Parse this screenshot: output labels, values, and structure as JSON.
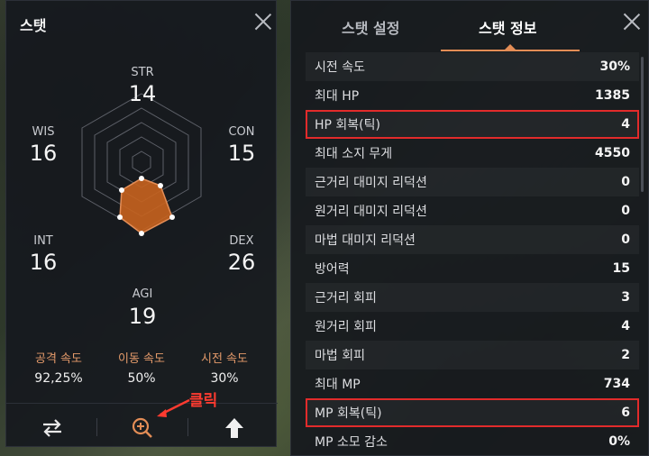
{
  "left_panel": {
    "title": "스탯",
    "stats": {
      "str": {
        "label": "STR",
        "value": "14"
      },
      "con": {
        "label": "CON",
        "value": "15"
      },
      "dex": {
        "label": "DEX",
        "value": "26"
      },
      "agi": {
        "label": "AGI",
        "value": "19"
      },
      "int": {
        "label": "INT",
        "value": "16"
      },
      "wis": {
        "label": "WIS",
        "value": "16"
      }
    },
    "speeds": [
      {
        "label": "공격 속도",
        "value": "92,25%"
      },
      {
        "label": "이동 속도",
        "value": "50%"
      },
      {
        "label": "시전 속도",
        "value": "30%"
      }
    ],
    "footer": {
      "swap_icon": "swap-arrows-icon",
      "zoom_icon": "zoom-in-icon",
      "upgrade_icon": "upgrade-arrow-icon"
    },
    "annotation": "클릭"
  },
  "right_panel": {
    "tabs": [
      {
        "label": "스탯 설정",
        "active": false
      },
      {
        "label": "스탯 정보",
        "active": true
      }
    ],
    "rows": [
      {
        "name": "시전 속도",
        "value": "30%",
        "highlight": false
      },
      {
        "name": "최대 HP",
        "value": "1385",
        "highlight": false
      },
      {
        "name": "HP 회복(틱)",
        "value": "4",
        "highlight": true
      },
      {
        "name": "최대 소지 무게",
        "value": "4550",
        "highlight": false
      },
      {
        "name": "근거리 대미지 리덕션",
        "value": "0",
        "highlight": false
      },
      {
        "name": "원거리 대미지 리덕션",
        "value": "0",
        "highlight": false
      },
      {
        "name": "마법 대미지 리덕션",
        "value": "0",
        "highlight": false
      },
      {
        "name": "방어력",
        "value": "15",
        "highlight": false
      },
      {
        "name": "근거리 회피",
        "value": "3",
        "highlight": false
      },
      {
        "name": "원거리 회피",
        "value": "4",
        "highlight": false
      },
      {
        "name": "마법 회피",
        "value": "2",
        "highlight": false
      },
      {
        "name": "최대 MP",
        "value": "734",
        "highlight": false
      },
      {
        "name": "MP 회복(틱)",
        "value": "6",
        "highlight": true
      },
      {
        "name": "MP 소모 감소",
        "value": "0%",
        "highlight": false
      }
    ]
  },
  "colors": {
    "accent": "#e38d56",
    "radar_fill": "#c8631e",
    "highlight_box": "#e22b2b",
    "annotation": "#ff3b30"
  }
}
